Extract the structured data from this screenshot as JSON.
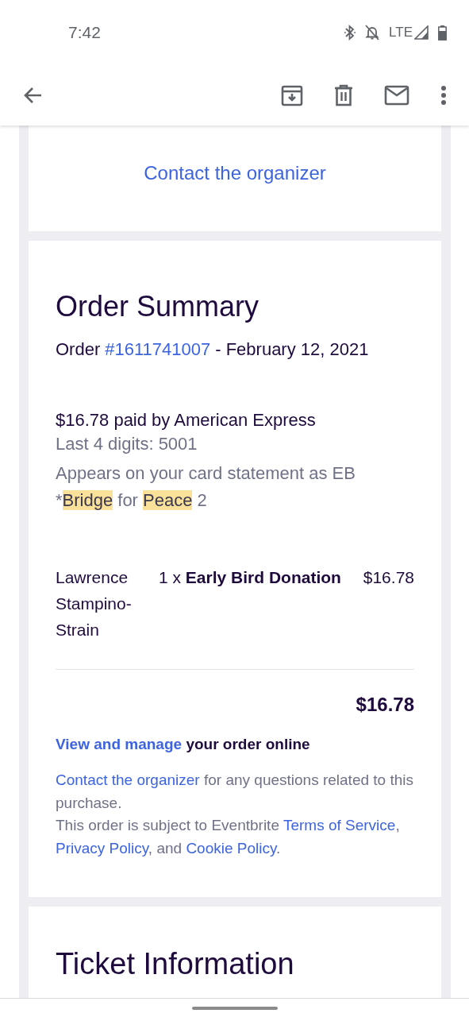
{
  "status_bar": {
    "time": "7:42",
    "network": "LTE"
  },
  "contact_card": {
    "link": "Contact the organizer"
  },
  "order_summary": {
    "title": "Order Summary",
    "order_label": "Order",
    "order_number": "#1611741007",
    "order_date": "- February 12, 2021",
    "payment": "$16.78 paid by American Express",
    "last_digits": "Last 4 digits: 5001",
    "statement": [
      {
        "text": "Appears on your card statement as EB *",
        "highlighted": false
      },
      {
        "text": "Bridge",
        "highlighted": true
      },
      {
        "text": " for ",
        "highlighted": false
      },
      {
        "text": "Peace",
        "highlighted": true
      },
      {
        "text": " 2",
        "highlighted": false
      }
    ],
    "line_item": {
      "attendee": "Lawrence Stampino-Strain",
      "description": "1 x **Early Bird Donation**",
      "price": "$16.78"
    },
    "total": "$16.78",
    "footer": [
      [
        {
          "kind": "link",
          "text": "View and manage"
        },
        {
          "kind": "text",
          "text": " your order online"
        }
      ],
      [
        {
          "kind": "link",
          "text": "Contact the organizer"
        },
        {
          "kind": "text",
          "text": " for any questions related to this purchase."
        }
      ],
      [
        {
          "kind": "text",
          "text": "This order is subject to Eventbrite "
        },
        {
          "kind": "link",
          "text": "Terms of Service"
        },
        {
          "kind": "text",
          "text": ", "
        },
        {
          "kind": "link",
          "text": "Privacy Policy"
        },
        {
          "kind": "text",
          "text": ", and "
        },
        {
          "kind": "link",
          "text": "Cookie Policy"
        },
        {
          "kind": "text",
          "text": "."
        }
      ]
    ]
  },
  "ticket_card": {
    "title": "Ticket Information"
  }
}
